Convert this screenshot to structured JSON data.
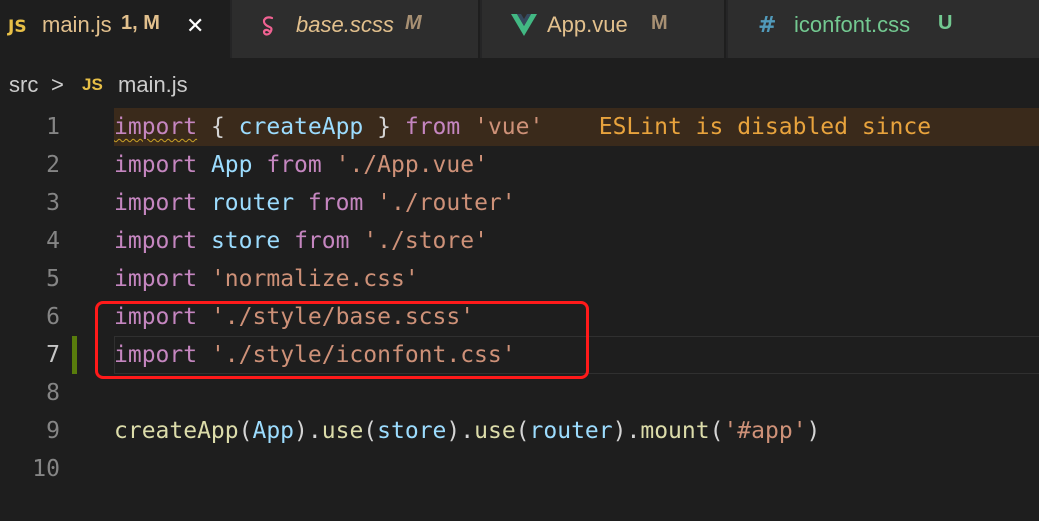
{
  "tabs": [
    {
      "icon": "JS",
      "name": "main.js",
      "status": "1, M",
      "close": "✕"
    },
    {
      "name": "base.scss",
      "status": "M"
    },
    {
      "name": "App.vue",
      "status": "M"
    },
    {
      "icon": "#",
      "name": "iconfont.css",
      "status": "U"
    }
  ],
  "breadcrumb": {
    "folder": "src",
    "sep": ">",
    "icon": "JS",
    "file": "main.js"
  },
  "lines": [
    {
      "num": "1",
      "warning": "ESLint is disabled since"
    },
    {
      "num": "2"
    },
    {
      "num": "3"
    },
    {
      "num": "4"
    },
    {
      "num": "5"
    },
    {
      "num": "6"
    },
    {
      "num": "7"
    },
    {
      "num": "8"
    },
    {
      "num": "9"
    },
    {
      "num": "10"
    }
  ],
  "tok": {
    "import": "import",
    "from": "from",
    "lbrace": "{ ",
    "rbrace": " }",
    "createApp": "createApp",
    "App": "App",
    "router": "router",
    "store": "store",
    "vue": "'vue'",
    "app_vue": "'./App.vue'",
    "router_path": "'./router'",
    "store_path": "'./store'",
    "normalize": "'normalize.css'",
    "base_scss": "'./style/base.scss'",
    "iconfont": "'./style/iconfont.css'",
    "use": "use",
    "mount": "mount",
    "app_sel": "'#app'",
    "lp": "(",
    "rp": ")",
    "dot": "."
  },
  "colors": {
    "keyword": "#c586c0",
    "variable": "#9cdcfe",
    "function": "#dcdcaa",
    "string": "#ce9178",
    "warning": "#e8a33d",
    "modified": "#587c0c",
    "annotation_box": "#ff1a1a"
  },
  "icons": {
    "js": "js-file-icon",
    "scss": "sass-icon",
    "vue": "vue-icon",
    "css": "css-hash-icon",
    "close": "close-icon"
  }
}
